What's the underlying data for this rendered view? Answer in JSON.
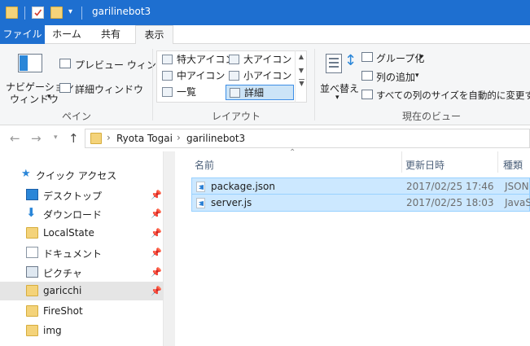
{
  "window": {
    "title": "garilinebot3"
  },
  "tabs": {
    "file": "ファイル",
    "home": "ホーム",
    "share": "共有",
    "view": "表示"
  },
  "ribbon": {
    "pane": {
      "nav_pane_line1": "ナビゲーション",
      "nav_pane_line2": "ウィンドウ",
      "preview_pane": "プレビュー ウィンドウ",
      "details_pane": "詳細ウィンドウ",
      "group_label": "ペイン"
    },
    "layout": {
      "extra_large_icons": "特大アイコン",
      "large_icons": "大アイコン",
      "medium_icons": "中アイコン",
      "small_icons": "小アイコン",
      "list": "一覧",
      "details": "詳細",
      "group_label": "レイアウト"
    },
    "current_view": {
      "sort_by": "並べ替え",
      "group_by": "グループ化",
      "add_columns": "列の追加",
      "size_all_columns": "すべての列のサイズを自動的に変更する",
      "group_label": "現在のビュー"
    }
  },
  "address": {
    "crumbs": [
      "Ryota Togai",
      "garilinebot3"
    ]
  },
  "nav": {
    "quick_access": "クイック アクセス",
    "items": [
      {
        "label": "デスクトップ",
        "pinned": true
      },
      {
        "label": "ダウンロード",
        "pinned": true
      },
      {
        "label": "LocalState",
        "pinned": true
      },
      {
        "label": "ドキュメント",
        "pinned": true
      },
      {
        "label": "ピクチャ",
        "pinned": true
      },
      {
        "label": "garicchi",
        "pinned": true
      },
      {
        "label": "FireShot",
        "pinned": false
      },
      {
        "label": "img",
        "pinned": false
      }
    ]
  },
  "filelist": {
    "columns": {
      "name": "名前",
      "date": "更新日時",
      "type": "種類"
    },
    "rows": [
      {
        "name": "package.json",
        "date": "2017/02/25 17:46",
        "type": "JSON"
      },
      {
        "name": "server.js",
        "date": "2017/02/25 18:03",
        "type": "JavaSc"
      }
    ]
  },
  "colors": {
    "accent": "#1e6fd0",
    "selection": "#cce8ff",
    "selection_border": "#99d1ff"
  }
}
